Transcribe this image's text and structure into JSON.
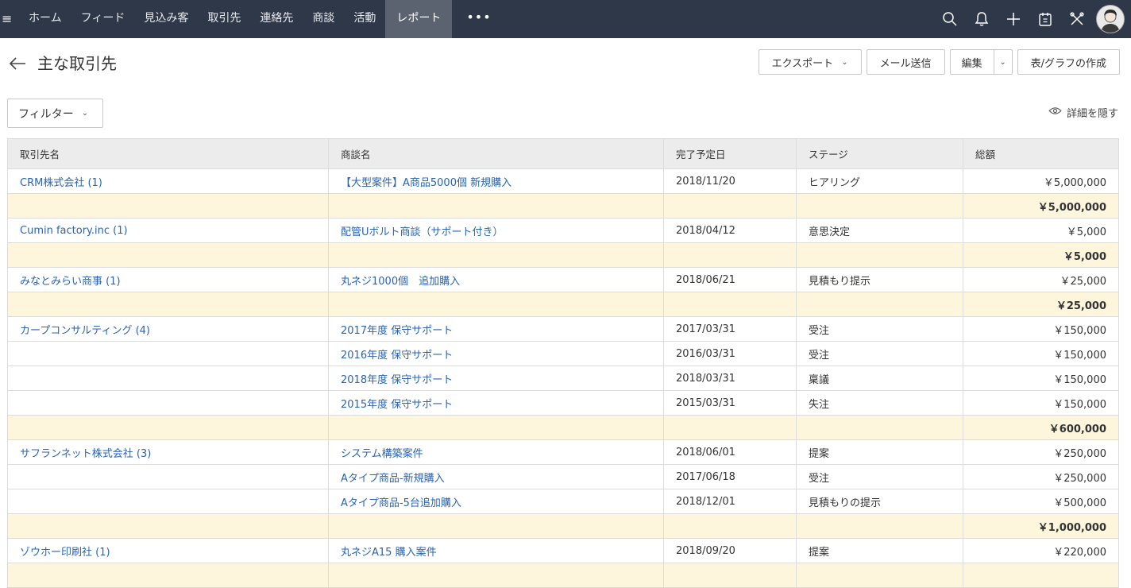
{
  "nav": {
    "items": [
      "ホーム",
      "フィード",
      "見込み客",
      "取引先",
      "連絡先",
      "商談",
      "活動"
    ],
    "active": "レポート",
    "more": "•••",
    "icons": [
      "search-icon",
      "bell-icon",
      "plus-icon",
      "calendar-icon",
      "tools-icon",
      "avatar"
    ]
  },
  "page": {
    "title": "主な取引先",
    "export_label": "エクスポート",
    "mail_label": "メール送信",
    "edit_label": "編集",
    "chart_label": "表/グラフの作成",
    "filter_label": "フィルター",
    "hide_detail_label": "詳細を隠す"
  },
  "table": {
    "headers": [
      "取引先名",
      "商談名",
      "完了予定日",
      "ステージ",
      "総額"
    ],
    "rows": [
      {
        "type": "data",
        "account": "CRM株式会社 (1)",
        "deal": "【大型案件】A商品5000個 新規購入",
        "date": "2018/11/20",
        "stage": "ヒアリング",
        "amount": "￥5,000,000"
      },
      {
        "type": "sub",
        "amount": "￥5,000,000"
      },
      {
        "type": "data",
        "account": "Cumin factory.inc (1)",
        "deal": "配管Uボルト商談（サポート付き）",
        "date": "2018/04/12",
        "stage": "意思決定",
        "amount": "￥5,000"
      },
      {
        "type": "sub",
        "amount": "￥5,000"
      },
      {
        "type": "data",
        "account": "みなとみらい商事 (1)",
        "deal": "丸ネジ1000個　追加購入",
        "date": "2018/06/21",
        "stage": "見積もり提示",
        "amount": "￥25,000"
      },
      {
        "type": "sub",
        "amount": "￥25,000"
      },
      {
        "type": "data",
        "account": "カープコンサルティング (4)",
        "deal": "2017年度 保守サポート",
        "date": "2017/03/31",
        "stage": "受注",
        "amount": "￥150,000"
      },
      {
        "type": "data",
        "account": "",
        "deal": "2016年度 保守サポート",
        "date": "2016/03/31",
        "stage": "受注",
        "amount": "￥150,000"
      },
      {
        "type": "data",
        "account": "",
        "deal": "2018年度 保守サポート",
        "date": "2018/03/31",
        "stage": "稟議",
        "amount": "￥150,000"
      },
      {
        "type": "data",
        "account": "",
        "deal": "2015年度 保守サポート",
        "date": "2015/03/31",
        "stage": "失注",
        "amount": "￥150,000"
      },
      {
        "type": "sub",
        "amount": "￥600,000"
      },
      {
        "type": "data",
        "account": "サフランネット株式会社 (3)",
        "deal": "システム構築案件",
        "date": "2018/06/01",
        "stage": "提案",
        "amount": "￥250,000"
      },
      {
        "type": "data",
        "account": "",
        "deal": "Aタイプ商品-新規購入",
        "date": "2017/06/18",
        "stage": "受注",
        "amount": "￥250,000"
      },
      {
        "type": "data",
        "account": "",
        "deal": "Aタイプ商品-5台追加購入",
        "date": "2018/12/01",
        "stage": "見積もりの提示",
        "amount": "￥500,000"
      },
      {
        "type": "sub",
        "amount": "￥1,000,000"
      },
      {
        "type": "data",
        "account": "ゾウホー印刷社 (1)",
        "deal": "丸ネジA15 購入案件",
        "date": "2018/09/20",
        "stage": "提案",
        "amount": "￥220,000"
      },
      {
        "type": "sub",
        "amount": ""
      }
    ]
  },
  "colors": {
    "topbar": "#2f3849",
    "active_tab": "#5c6370",
    "link": "#2a64b3",
    "subtotal_bg": "#fdf5dc"
  }
}
